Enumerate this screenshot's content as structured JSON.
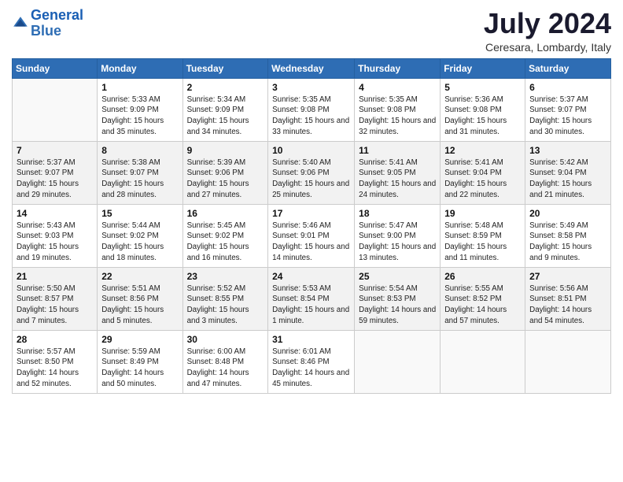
{
  "logo": {
    "line1": "General",
    "line2": "Blue"
  },
  "title": "July 2024",
  "subtitle": "Ceresara, Lombardy, Italy",
  "weekdays": [
    "Sunday",
    "Monday",
    "Tuesday",
    "Wednesday",
    "Thursday",
    "Friday",
    "Saturday"
  ],
  "weeks": [
    [
      {
        "day": "",
        "info": ""
      },
      {
        "day": "1",
        "info": "Sunrise: 5:33 AM\nSunset: 9:09 PM\nDaylight: 15 hours\nand 35 minutes."
      },
      {
        "day": "2",
        "info": "Sunrise: 5:34 AM\nSunset: 9:09 PM\nDaylight: 15 hours\nand 34 minutes."
      },
      {
        "day": "3",
        "info": "Sunrise: 5:35 AM\nSunset: 9:08 PM\nDaylight: 15 hours\nand 33 minutes."
      },
      {
        "day": "4",
        "info": "Sunrise: 5:35 AM\nSunset: 9:08 PM\nDaylight: 15 hours\nand 32 minutes."
      },
      {
        "day": "5",
        "info": "Sunrise: 5:36 AM\nSunset: 9:08 PM\nDaylight: 15 hours\nand 31 minutes."
      },
      {
        "day": "6",
        "info": "Sunrise: 5:37 AM\nSunset: 9:07 PM\nDaylight: 15 hours\nand 30 minutes."
      }
    ],
    [
      {
        "day": "7",
        "info": "Sunrise: 5:37 AM\nSunset: 9:07 PM\nDaylight: 15 hours\nand 29 minutes."
      },
      {
        "day": "8",
        "info": "Sunrise: 5:38 AM\nSunset: 9:07 PM\nDaylight: 15 hours\nand 28 minutes."
      },
      {
        "day": "9",
        "info": "Sunrise: 5:39 AM\nSunset: 9:06 PM\nDaylight: 15 hours\nand 27 minutes."
      },
      {
        "day": "10",
        "info": "Sunrise: 5:40 AM\nSunset: 9:06 PM\nDaylight: 15 hours\nand 25 minutes."
      },
      {
        "day": "11",
        "info": "Sunrise: 5:41 AM\nSunset: 9:05 PM\nDaylight: 15 hours\nand 24 minutes."
      },
      {
        "day": "12",
        "info": "Sunrise: 5:41 AM\nSunset: 9:04 PM\nDaylight: 15 hours\nand 22 minutes."
      },
      {
        "day": "13",
        "info": "Sunrise: 5:42 AM\nSunset: 9:04 PM\nDaylight: 15 hours\nand 21 minutes."
      }
    ],
    [
      {
        "day": "14",
        "info": "Sunrise: 5:43 AM\nSunset: 9:03 PM\nDaylight: 15 hours\nand 19 minutes."
      },
      {
        "day": "15",
        "info": "Sunrise: 5:44 AM\nSunset: 9:02 PM\nDaylight: 15 hours\nand 18 minutes."
      },
      {
        "day": "16",
        "info": "Sunrise: 5:45 AM\nSunset: 9:02 PM\nDaylight: 15 hours\nand 16 minutes."
      },
      {
        "day": "17",
        "info": "Sunrise: 5:46 AM\nSunset: 9:01 PM\nDaylight: 15 hours\nand 14 minutes."
      },
      {
        "day": "18",
        "info": "Sunrise: 5:47 AM\nSunset: 9:00 PM\nDaylight: 15 hours\nand 13 minutes."
      },
      {
        "day": "19",
        "info": "Sunrise: 5:48 AM\nSunset: 8:59 PM\nDaylight: 15 hours\nand 11 minutes."
      },
      {
        "day": "20",
        "info": "Sunrise: 5:49 AM\nSunset: 8:58 PM\nDaylight: 15 hours\nand 9 minutes."
      }
    ],
    [
      {
        "day": "21",
        "info": "Sunrise: 5:50 AM\nSunset: 8:57 PM\nDaylight: 15 hours\nand 7 minutes."
      },
      {
        "day": "22",
        "info": "Sunrise: 5:51 AM\nSunset: 8:56 PM\nDaylight: 15 hours\nand 5 minutes."
      },
      {
        "day": "23",
        "info": "Sunrise: 5:52 AM\nSunset: 8:55 PM\nDaylight: 15 hours\nand 3 minutes."
      },
      {
        "day": "24",
        "info": "Sunrise: 5:53 AM\nSunset: 8:54 PM\nDaylight: 15 hours\nand 1 minute."
      },
      {
        "day": "25",
        "info": "Sunrise: 5:54 AM\nSunset: 8:53 PM\nDaylight: 14 hours\nand 59 minutes."
      },
      {
        "day": "26",
        "info": "Sunrise: 5:55 AM\nSunset: 8:52 PM\nDaylight: 14 hours\nand 57 minutes."
      },
      {
        "day": "27",
        "info": "Sunrise: 5:56 AM\nSunset: 8:51 PM\nDaylight: 14 hours\nand 54 minutes."
      }
    ],
    [
      {
        "day": "28",
        "info": "Sunrise: 5:57 AM\nSunset: 8:50 PM\nDaylight: 14 hours\nand 52 minutes."
      },
      {
        "day": "29",
        "info": "Sunrise: 5:59 AM\nSunset: 8:49 PM\nDaylight: 14 hours\nand 50 minutes."
      },
      {
        "day": "30",
        "info": "Sunrise: 6:00 AM\nSunset: 8:48 PM\nDaylight: 14 hours\nand 47 minutes."
      },
      {
        "day": "31",
        "info": "Sunrise: 6:01 AM\nSunset: 8:46 PM\nDaylight: 14 hours\nand 45 minutes."
      },
      {
        "day": "",
        "info": ""
      },
      {
        "day": "",
        "info": ""
      },
      {
        "day": "",
        "info": ""
      }
    ]
  ]
}
